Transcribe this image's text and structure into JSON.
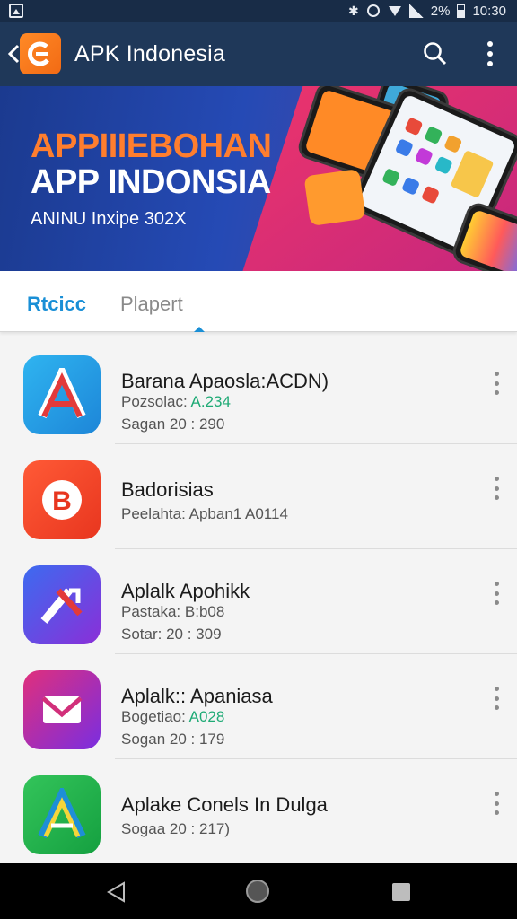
{
  "status_bar": {
    "icons": [
      "image-icon",
      "bluetooth-icon",
      "vibrate-icon",
      "wifi-icon",
      "signal-icon",
      "battery-icon"
    ],
    "battery": "2%",
    "time": "10:30"
  },
  "app_bar": {
    "title": "APK Indonesia",
    "icons": [
      "back-icon",
      "app-logo-icon",
      "search-icon",
      "more-vert-icon"
    ],
    "background": "#1f3859"
  },
  "banner": {
    "line1": "APPIIIEBOHAN",
    "line2": "APP INDONSIA",
    "line3": "ANINU Inxipe 302X"
  },
  "tabs": [
    {
      "label": "Rtcicc",
      "active": true
    },
    {
      "label": "Plapert",
      "active": false
    }
  ],
  "accent": "#1a8fd6",
  "apps": [
    {
      "name": "Barana Apaosla:ACDN)",
      "meta1_label": "Pozsolac:",
      "meta1_value": "A.234",
      "meta1_green": true,
      "meta2": "Sagan 20 : 290",
      "icon": "app-icon-a-red",
      "colors": [
        "#2fb4f0",
        "#1d86d8"
      ],
      "glyph": "A"
    },
    {
      "name": "Badorisias",
      "meta1_label": "Peelahta:",
      "meta1_value": "Apban1 A0114",
      "meta1_green": false,
      "meta2": "",
      "icon": "app-icon-b-orange",
      "colors": [
        "#ff5a36",
        "#e8361f"
      ],
      "glyph": "B"
    },
    {
      "name": "Aplalk Apohikk",
      "meta1_label": "Pastaka:",
      "meta1_value": "B:b08",
      "meta1_green": false,
      "meta2": "Sotar: 20 : 309",
      "icon": "app-icon-slash-purple",
      "colors": [
        "#3c6bf0",
        "#8a2fd8"
      ],
      "glyph": "\\"
    },
    {
      "name": "Aplalk:: Apaniasa",
      "meta1_label": "Bogetiao:",
      "meta1_value": "A028",
      "meta1_green": true,
      "meta2": "Sogan 20 : 179",
      "icon": "app-icon-mail-magenta",
      "colors": [
        "#e02f7c",
        "#7a2ee0"
      ],
      "glyph": "✉"
    },
    {
      "name": "Aplake Conels In Dulga",
      "meta1_label": "Sogaa 20 :",
      "meta1_value": "217)",
      "meta1_green": false,
      "meta2": "",
      "icon": "app-icon-a-green",
      "colors": [
        "#33c45a",
        "#15a040"
      ],
      "glyph": "A"
    }
  ],
  "nav_bar": {
    "icons": [
      "nav-back-icon",
      "nav-home-icon",
      "nav-recents-icon"
    ]
  }
}
